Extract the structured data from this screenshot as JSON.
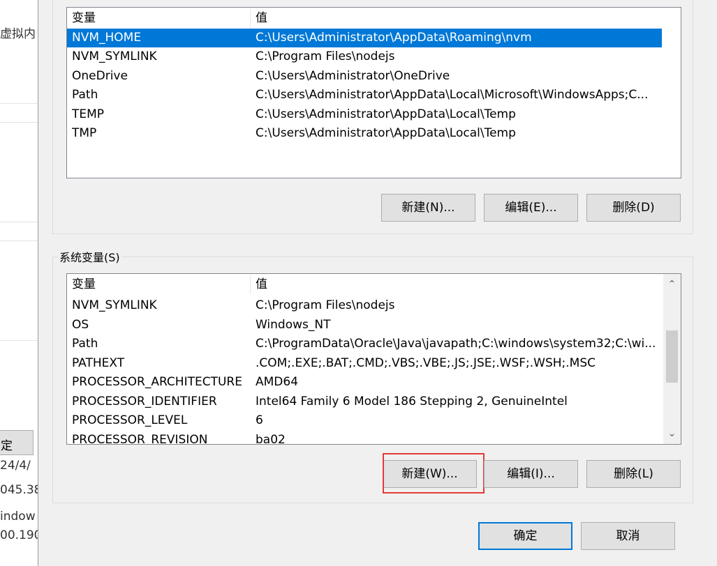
{
  "background_window": {
    "fragments": [
      "虚拟内",
      "定",
      "24/4/",
      "045.38",
      "indow",
      "00.190"
    ]
  },
  "user_vars": {
    "header": {
      "name": "变量",
      "value": "值"
    },
    "rows": [
      {
        "name": "NVM_HOME",
        "value": "C:\\Users\\Administrator\\AppData\\Roaming\\nvm",
        "selected": true
      },
      {
        "name": "NVM_SYMLINK",
        "value": "C:\\Program Files\\nodejs"
      },
      {
        "name": "OneDrive",
        "value": "C:\\Users\\Administrator\\OneDrive"
      },
      {
        "name": "Path",
        "value": "C:\\Users\\Administrator\\AppData\\Local\\Microsoft\\WindowsApps;C..."
      },
      {
        "name": "TEMP",
        "value": "C:\\Users\\Administrator\\AppData\\Local\\Temp"
      },
      {
        "name": "TMP",
        "value": "C:\\Users\\Administrator\\AppData\\Local\\Temp"
      }
    ],
    "buttons": {
      "new": "新建(N)...",
      "edit": "编辑(E)...",
      "delete": "删除(D)"
    }
  },
  "system_vars": {
    "label": "系统变量(S)",
    "header": {
      "name": "变量",
      "value": "值"
    },
    "rows": [
      {
        "name": "NVM_SYMLINK",
        "value": "C:\\Program Files\\nodejs"
      },
      {
        "name": "OS",
        "value": "Windows_NT"
      },
      {
        "name": "Path",
        "value": "C:\\ProgramData\\Oracle\\Java\\javapath;C:\\windows\\system32;C:\\wi..."
      },
      {
        "name": "PATHEXT",
        "value": ".COM;.EXE;.BAT;.CMD;.VBS;.VBE;.JS;.JSE;.WSF;.WSH;.MSC"
      },
      {
        "name": "PROCESSOR_ARCHITECTURE",
        "value": "AMD64"
      },
      {
        "name": "PROCESSOR_IDENTIFIER",
        "value": "Intel64 Family 6 Model 186 Stepping 2, GenuineIntel"
      },
      {
        "name": "PROCESSOR_LEVEL",
        "value": "6"
      },
      {
        "name": "PROCESSOR_REVISION",
        "value": "ba02"
      }
    ],
    "buttons": {
      "new": "新建(W)...",
      "edit": "编辑(I)...",
      "delete": "删除(L)"
    }
  },
  "dialog_buttons": {
    "ok": "确定",
    "cancel": "取消"
  },
  "icons": {
    "scroll_up": "chevron-up-icon",
    "scroll_down": "chevron-down-icon"
  },
  "colors": {
    "selection": "#0078d7",
    "highlight_box": "#e53935"
  }
}
